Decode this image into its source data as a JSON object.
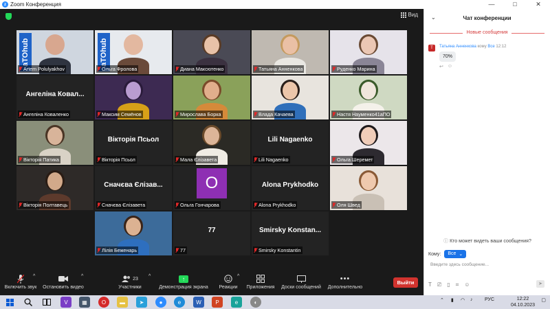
{
  "window": {
    "title": "Zoom Конференция",
    "minimize": "—",
    "maximize": "□",
    "close": "✕"
  },
  "view_label": "Вид",
  "tiles": [
    {
      "name": "Artem Polulyakhov",
      "type": "video",
      "active": true,
      "bg": "#cfd6df",
      "skin": "#d8a78f",
      "shirt": "#2f3440",
      "accent": "#1f63c8",
      "badge": "aTOhub"
    },
    {
      "name": "Ольга Фролова",
      "type": "video",
      "bg": "#e7eaee",
      "skin": "#e3b8a0",
      "shirt": "#6a4a3a",
      "accent": "#1f63c8",
      "badge": "aTOhub"
    },
    {
      "name": "Диана Максютенко",
      "type": "video",
      "bg": "#4a4a55",
      "skin": "#e8c2a8",
      "shirt": "#3b3140",
      "hair": "#5a3b25"
    },
    {
      "name": "Татьяна Анненкова",
      "type": "video",
      "bg": "#bfb9b1",
      "skin": "#eac0a5",
      "shirt": "#e9e7e2",
      "hair": "#c49a5e"
    },
    {
      "name": "Руденко Марина",
      "type": "video",
      "bg": "#e6e3ea",
      "skin": "#ebc7b4",
      "shirt": "#8a8596",
      "hair": "#6a4a34"
    },
    {
      "name": "Ангеліна Коваленко",
      "type": "text",
      "big": "Ангеліна Ковал..."
    },
    {
      "name": "Максим Семёнов",
      "type": "video",
      "bg": "#3d2a52",
      "skin": "#b99cd0",
      "shirt": "#d7a018",
      "hair": "#2a1b3a"
    },
    {
      "name": "Мирослава Борка",
      "type": "video",
      "bg": "#8aa15a",
      "skin": "#e1ae8c",
      "shirt": "#d58a3a",
      "hair": "#7a4a2a"
    },
    {
      "name": "Влада Качаева",
      "type": "video",
      "bg": "#e8e4de",
      "skin": "#ecc6aa",
      "shirt": "#2f6fba",
      "hair": "#2a1f1a"
    },
    {
      "name": "Настя Науменко41аПО",
      "type": "video",
      "bg": "#cfd9c2",
      "skin": "#f0e6dc",
      "shirt": "#f4f1ea",
      "hair": "#3a5a2a"
    },
    {
      "name": "Вікторія Патика",
      "type": "video",
      "bg": "#8a8f7a",
      "skin": "#d8b49a",
      "shirt": "#d9d2c6",
      "hair": "#4a3525"
    },
    {
      "name": "Вікторія Псьол",
      "type": "text",
      "big": "Вікторія Псьол"
    },
    {
      "name": "Мала Єлізавета",
      "type": "video",
      "bg": "#2b2a25",
      "skin": "#dcb598",
      "shirt": "#f0ece4",
      "hair": "#6a4a2a"
    },
    {
      "name": "Lili Nagaenko",
      "type": "text",
      "big": "Lili Nagaenko"
    },
    {
      "name": "Ольга Шеремет",
      "type": "video",
      "bg": "#ece7ea",
      "skin": "#f0cdb9",
      "shirt": "#2d2a30",
      "hair": "#1e1a1c"
    },
    {
      "name": "Вікторія Полтавець",
      "type": "video",
      "bg": "#2e2a28",
      "skin": "#d2a98a",
      "shirt": "#5d3a2c",
      "hair": "#2a1c14"
    },
    {
      "name": "Сначєва Єлізавета",
      "type": "text",
      "big": "Сначєва Єлізав..."
    },
    {
      "name": "Ольга Гончарова",
      "type": "avatar",
      "letter": "O"
    },
    {
      "name": "Alona Prykhodko",
      "type": "text",
      "big": "Alona Prykhodko"
    },
    {
      "name": "Оля Швед",
      "type": "video",
      "bg": "#e8e1da",
      "skin": "#efc9ae",
      "shirt": "#c9c0b5",
      "hair": "#8a5a36"
    },
    {
      "name": "Лілія Беженарь",
      "type": "video",
      "bg": "#3c6b9a",
      "skin": "#dcb292",
      "shirt": "#2e6fbf",
      "hair": "#3a2418"
    },
    {
      "name": "77",
      "type": "text",
      "big": "77"
    },
    {
      "name": "Smirsky Konstantin",
      "type": "text",
      "big": "Smirsky Konstan..."
    }
  ],
  "toolbar": {
    "mute": "Включить звук",
    "video": "Остановить видео",
    "participants": "Участники",
    "participants_count": "23",
    "share": "Демонстрация экрана",
    "reactions": "Реакции",
    "apps": "Приложения",
    "whiteboards": "Доски сообщений",
    "more": "Дополнительно",
    "leave": "Выйти"
  },
  "chat": {
    "title": "Чат конференции",
    "new_messages": "Новые сообщения",
    "message": {
      "avatar_letter": "T",
      "sender": "Татьяна Анненкова",
      "to_word": "кому",
      "recipient": "Все",
      "time": "12:12",
      "text": "70%"
    },
    "who_can_see": "Кто может видеть ваши сообщения?",
    "to_label": "Кому:",
    "to_value": "Все",
    "input_placeholder": "Введите здесь сообщение..."
  },
  "taskbar": {
    "lang": "РУС",
    "time": "12:22",
    "date": "04.10.2023"
  },
  "colors": {
    "zoom_blue": "#2d8cff",
    "share_green": "#23d959",
    "leave_red": "#d1332e",
    "active_speaker": "#f2e14b",
    "avatar_purple": "#8e2fb3"
  }
}
